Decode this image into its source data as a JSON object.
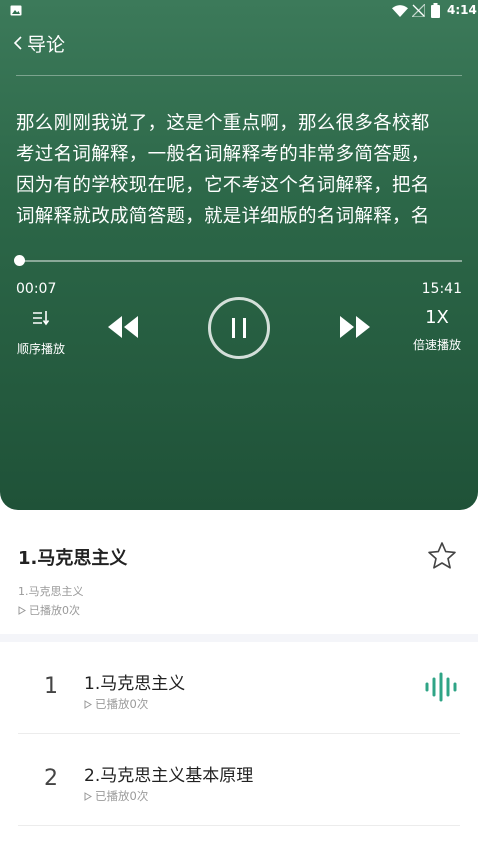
{
  "status_bar": {
    "time": "4:14"
  },
  "header": {
    "title": "导论"
  },
  "lyrics": [
    "那么刚刚我说了，这是个重点啊，那么很多各校都",
    "考过名词解释，一般名词解释考的非常多简答题，",
    "因为有的学校现在呢，它不考这个名词解释，把名",
    "词解释就改成简答题，就是详细版的名词解释，名"
  ],
  "player": {
    "current_time": "00:07",
    "total_time": "15:41",
    "progress": 0.0074,
    "order_label": "顺序播放",
    "speed_value": "1X",
    "speed_label": "倍速播放"
  },
  "course": {
    "title": "1.马克思主义",
    "subtitle": "1.马克思主义",
    "play_count": "已播放0次"
  },
  "episodes": [
    {
      "index": "1",
      "title": "1.马克思主义",
      "play_count": "已播放0次"
    },
    {
      "index": "2",
      "title": "2.马克思主义基本原理",
      "play_count": "已播放0次"
    }
  ],
  "colors": {
    "accent": "#2fa486",
    "player_bg": "#2c6748"
  }
}
